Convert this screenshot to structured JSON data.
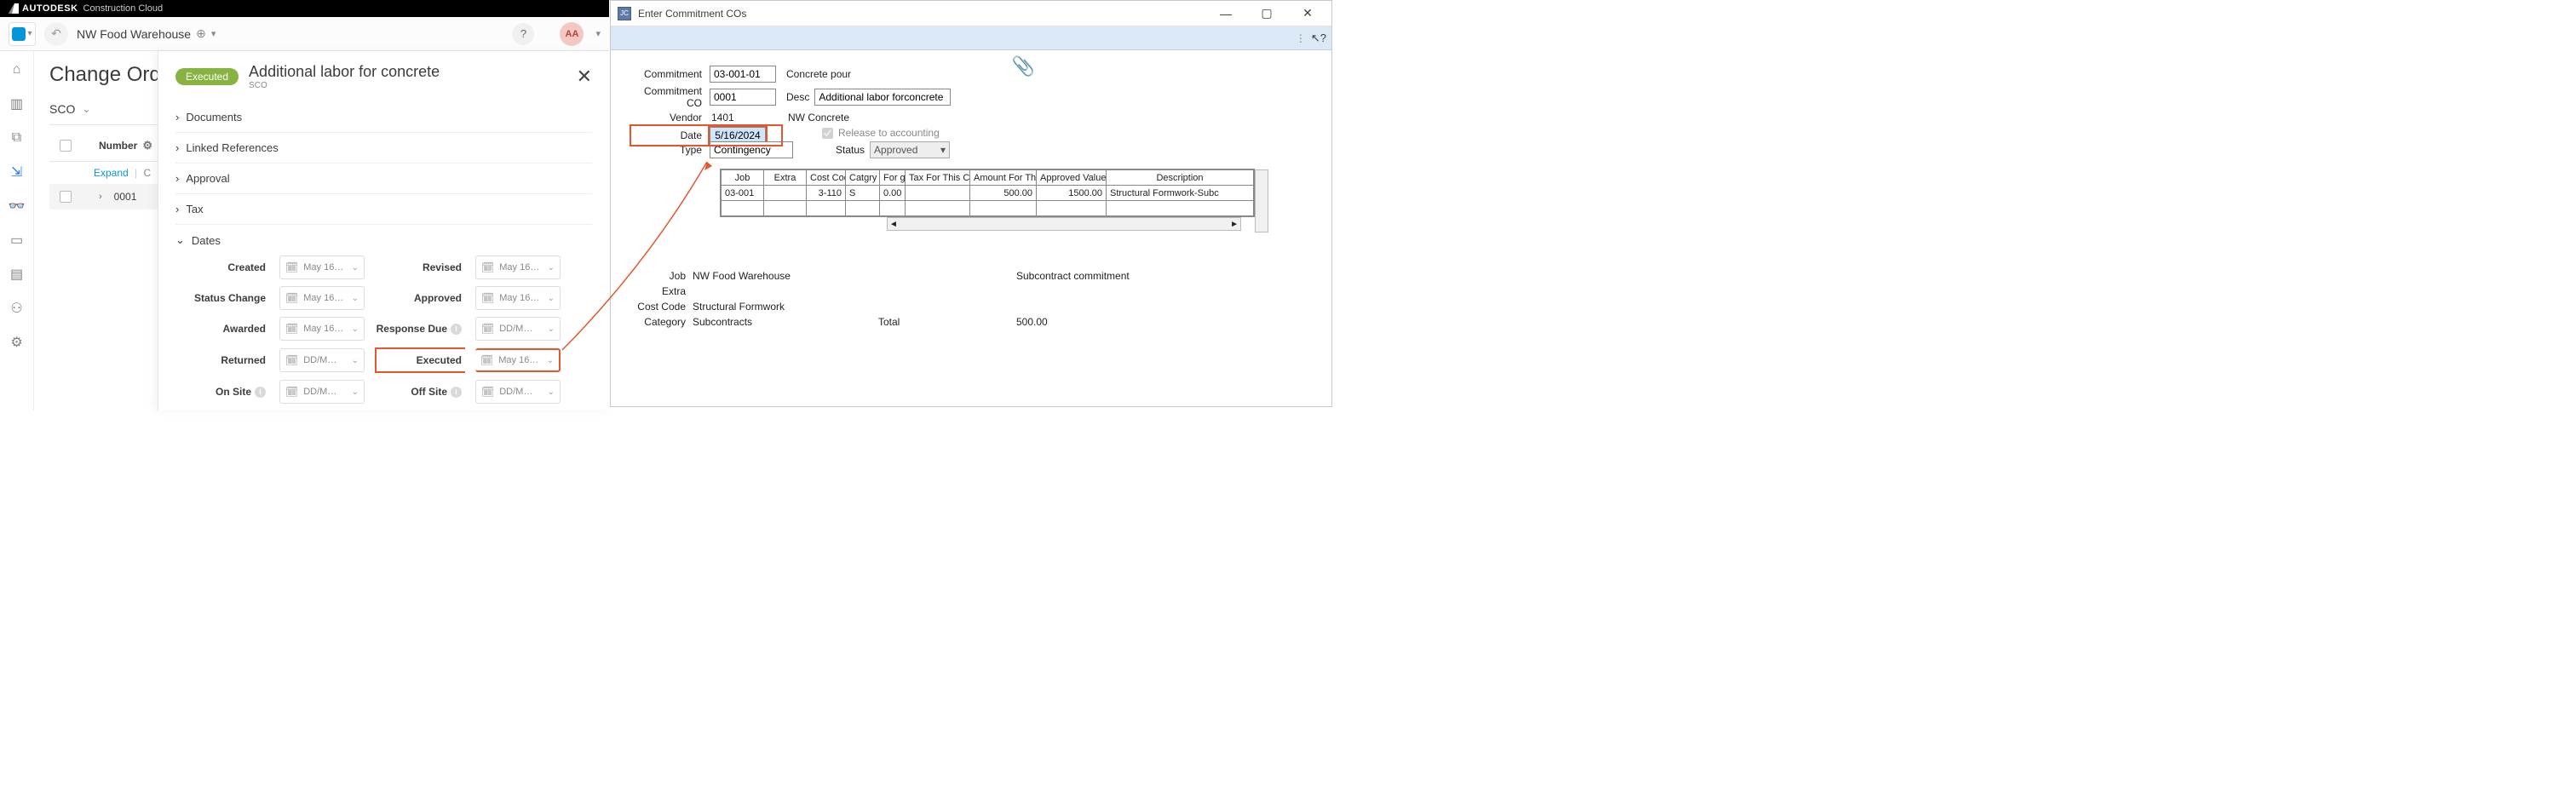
{
  "acc": {
    "brand_a": "AUTODESK",
    "brand_b": "Construction Cloud",
    "project": "NW Food Warehouse",
    "avatar": "AA",
    "page_title": "Change Ord",
    "tab": "SCO",
    "col_number": "Number",
    "expand": "Expand",
    "collapse": "C",
    "row_id": "0001",
    "panel": {
      "status": "Executed",
      "title": "Additional labor for concrete",
      "subtitle": "SCO",
      "sections": {
        "documents": "Documents",
        "linked": "Linked References",
        "approval": "Approval",
        "tax": "Tax",
        "dates": "Dates"
      },
      "dates": {
        "created": {
          "label": "Created",
          "value": "May 16…"
        },
        "revised": {
          "label": "Revised",
          "value": "May 16…"
        },
        "status_change": {
          "label": "Status Change",
          "value": "May 16…"
        },
        "approved": {
          "label": "Approved",
          "value": "May 16…"
        },
        "awarded": {
          "label": "Awarded",
          "value": "May 16…"
        },
        "response_due": {
          "label": "Response Due",
          "value": "DD/M…"
        },
        "returned": {
          "label": "Returned",
          "value": "DD/M…"
        },
        "executed": {
          "label": "Executed",
          "value": "May 16…"
        },
        "on_site": {
          "label": "On Site",
          "value": "DD/M…"
        },
        "off_site": {
          "label": "Off Site",
          "value": "DD/M…"
        }
      }
    }
  },
  "sage": {
    "title": "Enter Commitment COs",
    "commitment": {
      "label": "Commitment",
      "value": "03-001-01",
      "desc": "Concrete pour"
    },
    "co": {
      "label": "Commitment CO",
      "value": "0001",
      "desc_label": "Desc",
      "desc_value": "Additional labor forconcrete"
    },
    "vendor": {
      "label": "Vendor",
      "id": "1401",
      "name": "NW Concrete"
    },
    "date": {
      "label": "Date",
      "value": "5/16/2024"
    },
    "type": {
      "label": "Type",
      "value": "Contingency"
    },
    "release": "Release to accounting",
    "status": {
      "label": "Status",
      "value": "Approved"
    },
    "grid": {
      "cols": [
        "Job",
        "Extra",
        "Cost Code",
        "Catgry",
        "For ge",
        "Tax For This Change",
        "Amount For This Change",
        "Approved Value To Date",
        "Description"
      ],
      "rows": [
        {
          "job": "03-001",
          "extra": "",
          "code": "3-110",
          "cat": "S",
          "for": "0.00",
          "tax": "",
          "amount": "500.00",
          "approved": "1500.00",
          "desc": "Structural Formwork-Subc"
        }
      ]
    },
    "summary": {
      "job_l": "Job",
      "job_v": "NW Food Warehouse",
      "subc_v": "Subcontract commitment",
      "extra_l": "Extra",
      "code_l": "Cost Code",
      "code_v": "Structural Formwork",
      "cat_l": "Category",
      "cat_v": "Subcontracts",
      "total_l": "Total",
      "total_v": "500.00"
    }
  }
}
